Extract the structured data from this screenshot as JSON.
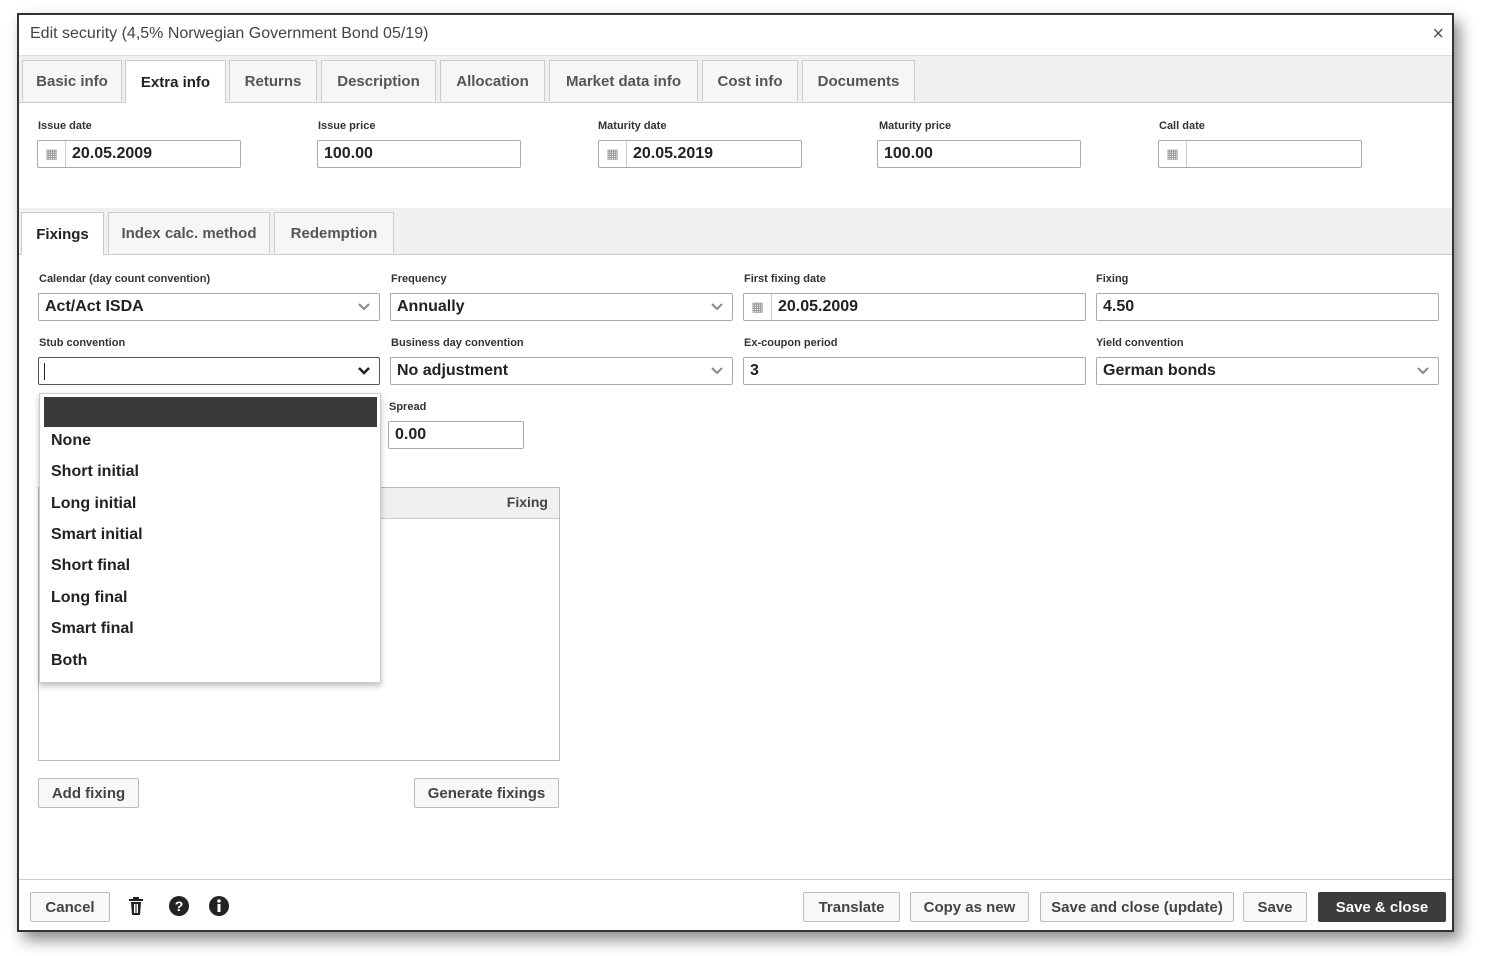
{
  "window": {
    "title": "Edit security (4,5% Norwegian Government Bond 05/19)",
    "close_glyph": "×"
  },
  "top_tabs": [
    "Basic info",
    "Extra info",
    "Returns",
    "Description",
    "Allocation",
    "Market data info",
    "Cost info",
    "Documents"
  ],
  "extra_info": {
    "issue_date": {
      "label": "Issue date",
      "value": "20.05.2009"
    },
    "issue_price": {
      "label": "Issue price",
      "value": "100.00"
    },
    "maturity_date": {
      "label": "Maturity date",
      "value": "20.05.2019"
    },
    "maturity_price": {
      "label": "Maturity price",
      "value": "100.00"
    },
    "call_date": {
      "label": "Call date",
      "value": ""
    }
  },
  "sub_tabs": [
    "Fixings",
    "Index calc. method",
    "Redemption"
  ],
  "fixings": {
    "calendar": {
      "label": "Calendar (day count convention)",
      "value": "Act/Act ISDA"
    },
    "frequency": {
      "label": "Frequency",
      "value": "Annually"
    },
    "first_fixing_date": {
      "label": "First fixing date",
      "value": "20.05.2009"
    },
    "fixing": {
      "label": "Fixing",
      "value": "4.50"
    },
    "stub_convention": {
      "label": "Stub convention",
      "value": ""
    },
    "business_day_convention": {
      "label": "Business day convention",
      "value": "No adjustment"
    },
    "ex_coupon_period": {
      "label": "Ex-coupon period",
      "value": "3"
    },
    "yield_convention": {
      "label": "Yield convention",
      "value": "German bonds"
    },
    "spread": {
      "label": "Spread",
      "value": "0.00"
    }
  },
  "stub_dropdown_options": [
    "None",
    "Short initial",
    "Long initial",
    "Smart initial",
    "Short final",
    "Long final",
    "Smart final",
    "Both"
  ],
  "fixings_grid": {
    "column_header": "Fixing"
  },
  "buttons": {
    "add_fixing": "Add fixing",
    "generate_fixings": "Generate fixings"
  },
  "footer": {
    "cancel": "Cancel",
    "translate": "Translate",
    "copy_as_new": "Copy as new",
    "save_and_close_update": "Save and close (update)",
    "save": "Save",
    "save_and_close": "Save & close"
  },
  "colors": {
    "accent_dark": "#3c3c3c",
    "tab_bar": "#f0f0f0"
  },
  "icons": [
    "calendar-icon",
    "chevron-down-icon",
    "trash-icon",
    "help-icon",
    "info-icon",
    "close-icon"
  ]
}
